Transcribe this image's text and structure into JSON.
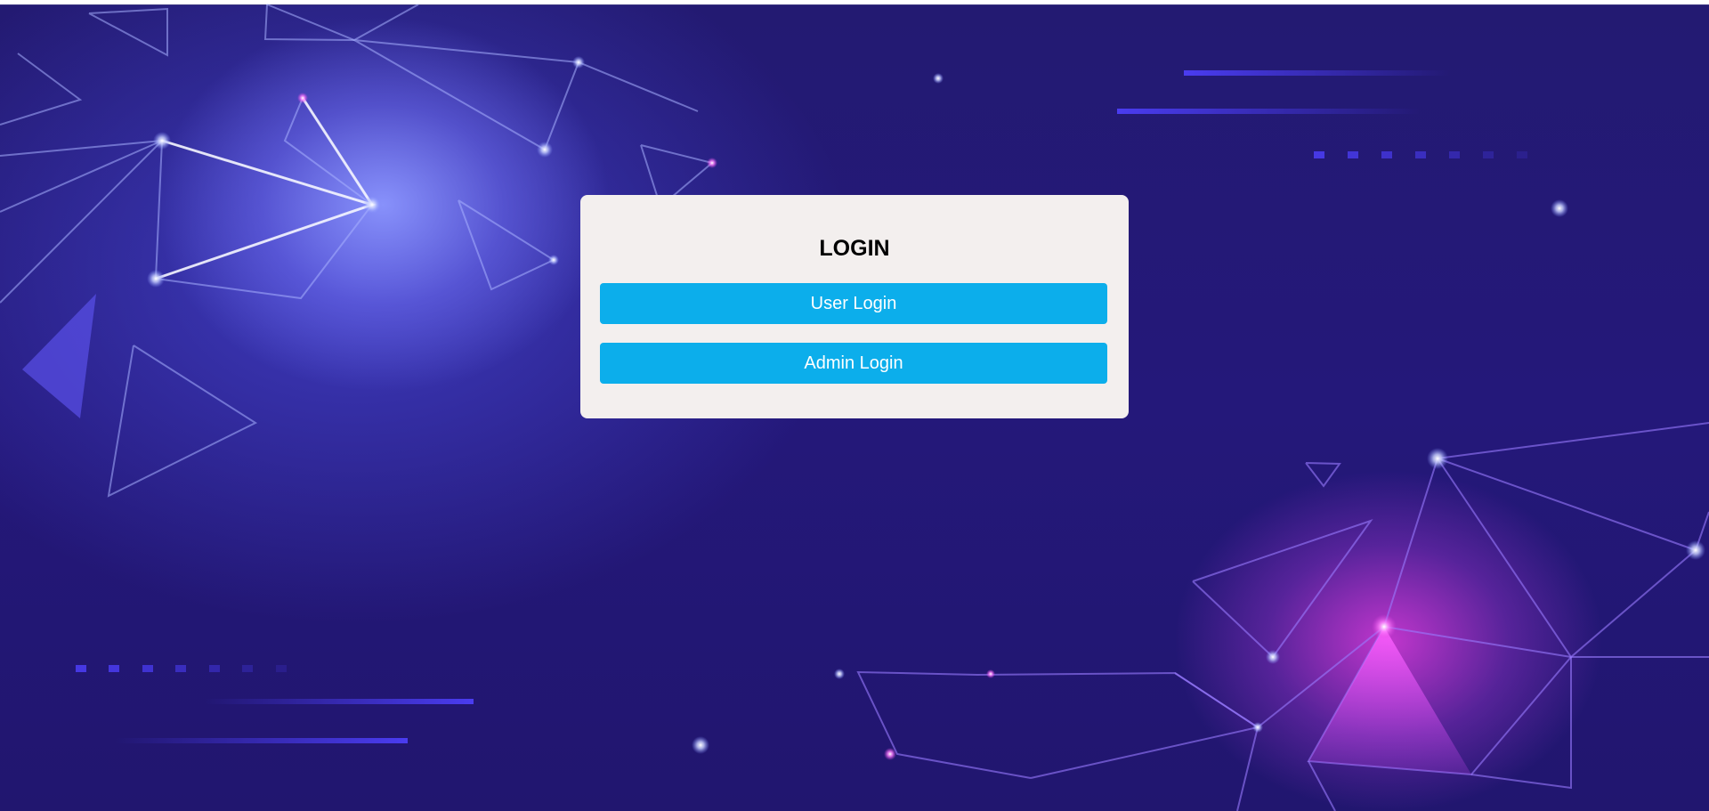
{
  "login": {
    "title": "LOGIN",
    "user_button_label": "User Login",
    "admin_button_label": "Admin Login"
  },
  "colors": {
    "background": "#231a72",
    "card": "#f3efee",
    "button": "#0caeeb",
    "button_text": "#ffffff",
    "title_text": "#000000"
  },
  "background_decoration": "polygon-network-art"
}
